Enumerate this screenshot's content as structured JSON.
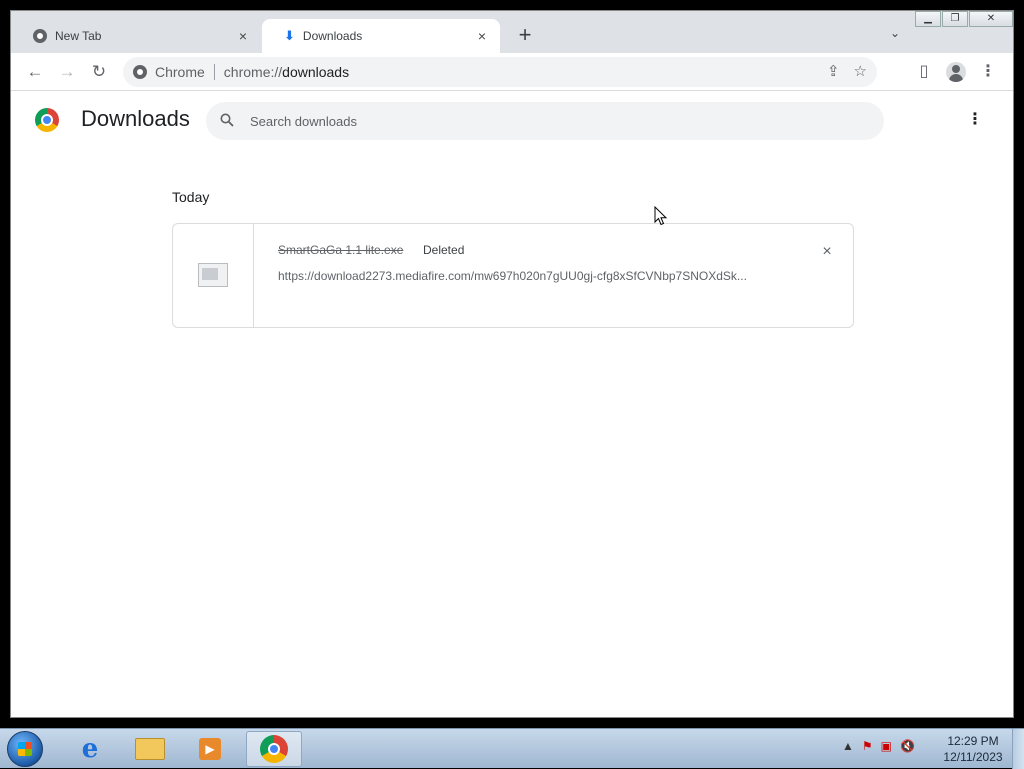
{
  "tabs": [
    {
      "title": "New Tab"
    },
    {
      "title": "Downloads"
    }
  ],
  "toolbar": {
    "site_label": "Chrome",
    "url_prefix": "chrome://",
    "url_host": "downloads"
  },
  "page": {
    "title": "Downloads",
    "search_placeholder": "Search downloads",
    "section": "Today"
  },
  "download": {
    "file_name": "SmartGaGa 1.1 lite.exe",
    "status": "Deleted",
    "url": "https://download2273.mediafire.com/mw697h020n7gUU0gj-cfg8xSfCVNbp7SNOXdSk..."
  },
  "taskbar": {
    "time": "12:29 PM",
    "date": "12/11/2023"
  },
  "icons": {
    "close": "×",
    "plus": "+",
    "chevron": "⌄",
    "back": "←",
    "forward": "→",
    "reload": "↻",
    "search": "🔍",
    "more": "⋮",
    "star": "☆",
    "share": "⇪",
    "sidepanel": "▯"
  }
}
